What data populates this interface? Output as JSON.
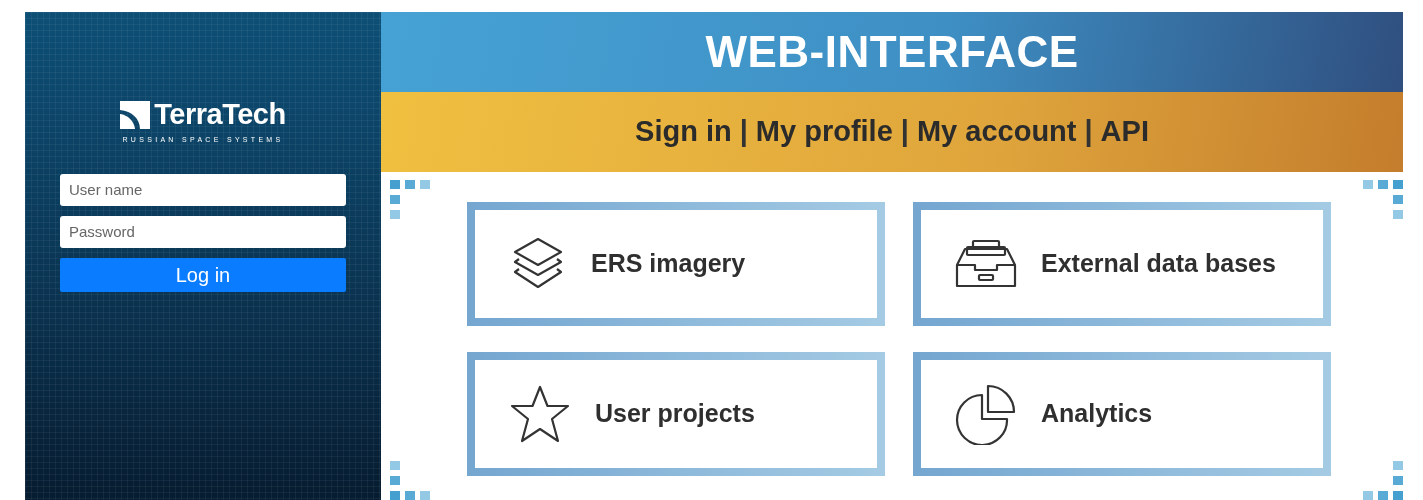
{
  "sidebar": {
    "logo": {
      "name": "TerraTech",
      "tagline": "RUSSIAN SPACE SYSTEMS"
    },
    "fields": [
      {
        "placeholder": "User name"
      },
      {
        "placeholder": "Password"
      }
    ],
    "login_button": "Log in"
  },
  "header": {
    "title": "WEB-INTERFACE"
  },
  "nav": [
    {
      "kind": "link",
      "text": "Sign in"
    },
    {
      "kind": "separator",
      "text": "|"
    },
    {
      "kind": "link",
      "text": "My profile"
    },
    {
      "kind": "separator",
      "text": "|"
    },
    {
      "kind": "link",
      "text": "My account"
    },
    {
      "kind": "separator",
      "text": "|"
    },
    {
      "kind": "link",
      "text": "API"
    }
  ],
  "tiles": [
    {
      "kind": "layers",
      "label": "ERS imagery"
    },
    {
      "kind": "archive",
      "label": "External data bases"
    },
    {
      "kind": "star",
      "label": "User projects"
    },
    {
      "kind": "pie",
      "label": "Analytics"
    }
  ]
}
